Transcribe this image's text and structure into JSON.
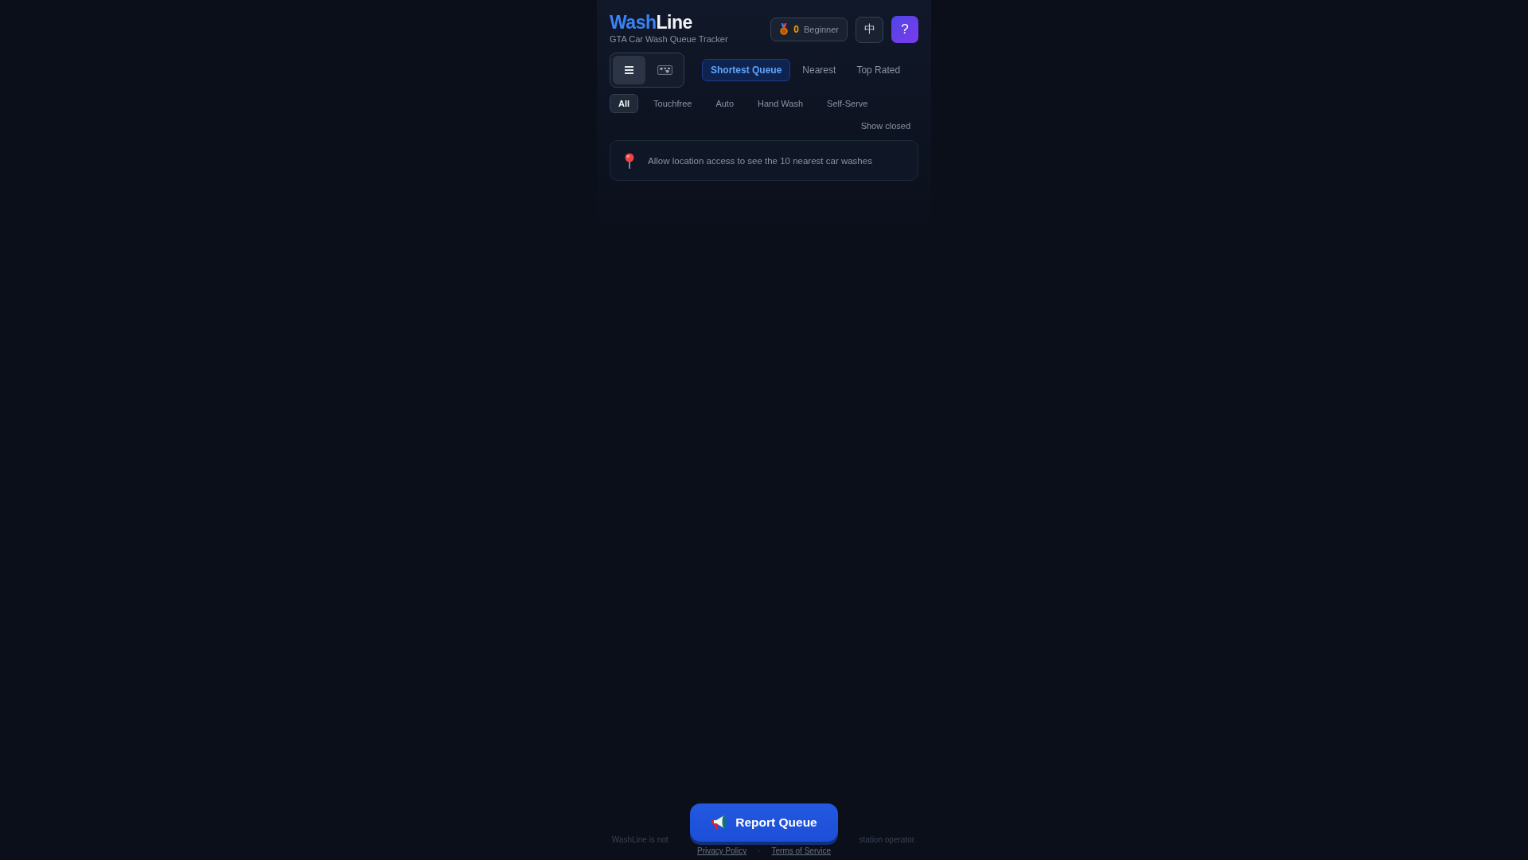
{
  "header": {
    "logo": {
      "part_1": "Wash",
      "part_2": "Line"
    },
    "subtitle": "GTA Car Wash Queue Tracker",
    "points": {
      "count": "0",
      "rank": "Beginner"
    },
    "language_button": "中",
    "help_button": "?"
  },
  "view_toggle": [
    {
      "kind": "list",
      "selected": true
    },
    {
      "kind": "map",
      "selected": false
    }
  ],
  "sort_tabs": [
    {
      "label": "Shortest Queue",
      "selected": true
    },
    {
      "label": "Nearest",
      "selected": false
    },
    {
      "label": "Top Rated",
      "selected": false
    }
  ],
  "type_filters": [
    {
      "label": "All",
      "selected": true
    },
    {
      "label": "Touchfree",
      "selected": false
    },
    {
      "label": "Auto",
      "selected": false
    },
    {
      "label": "Hand Wash",
      "selected": false
    },
    {
      "label": "Self-Serve",
      "selected": false
    }
  ],
  "show_closed": "Show closed",
  "location_notice": "Allow location access to see the 10 nearest car washes",
  "report_button": "Report Queue",
  "footer": {
    "disclaimer_start": "WashLine is not",
    "disclaimer_end": "station operator.",
    "separator": "·",
    "links": [
      "Privacy Policy",
      "Terms of Service"
    ]
  }
}
